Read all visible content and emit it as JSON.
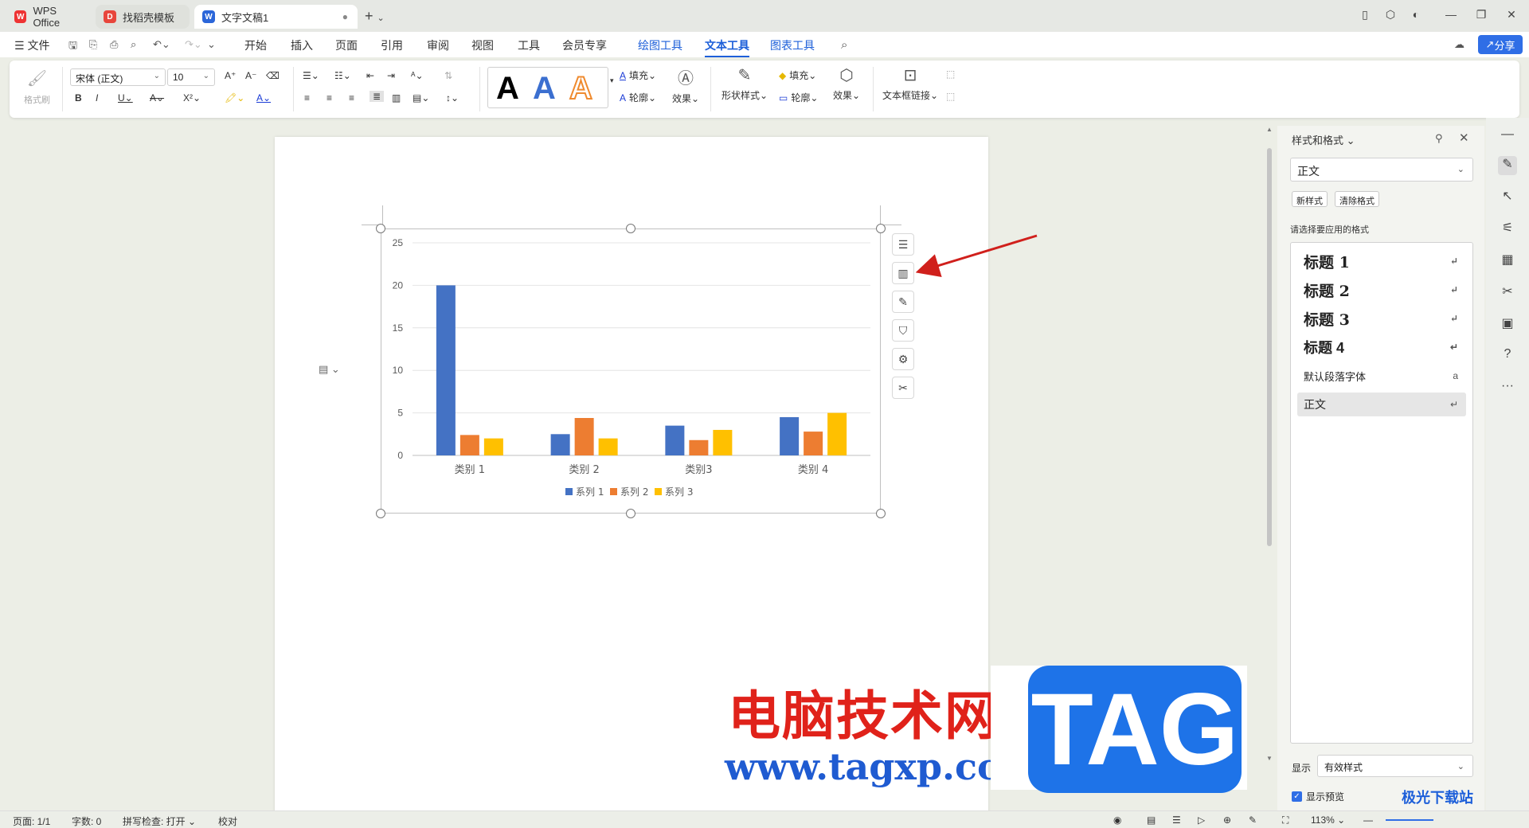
{
  "tabs": [
    {
      "label": "WPS Office",
      "icon": "wps-logo-icon"
    },
    {
      "label": "找稻壳模板",
      "icon": "docer-icon"
    },
    {
      "label": "文字文稿1",
      "icon": "writer-doc-icon"
    }
  ],
  "menu": {
    "file": "文件",
    "items": [
      "开始",
      "插入",
      "页面",
      "引用",
      "审阅",
      "视图",
      "工具",
      "会员专享",
      "绘图工具",
      "文本工具",
      "图表工具"
    ],
    "active": "文本工具",
    "share": "分享"
  },
  "ribbon": {
    "format_painter": "格式刷",
    "font_name": "宋体 (正文)",
    "font_size": "10",
    "fill": "填充",
    "outline": "轮廓",
    "effect": "效果",
    "shape_style": "形状样式",
    "shape_fill": "填充",
    "shape_outline": "轮廓",
    "shape_effect": "效果",
    "textbox_link": "文本框链接",
    "gallery": [
      "A",
      "A",
      "A"
    ]
  },
  "chart_data": {
    "type": "bar",
    "categories": [
      "类别 1",
      "类别 2",
      "类别3",
      "类别 4"
    ],
    "series": [
      {
        "name": "系列 1",
        "values": [
          20,
          2.5,
          3.5,
          4.5
        ],
        "color": "#4472c4"
      },
      {
        "name": "系列 2",
        "values": [
          2.4,
          4.4,
          1.8,
          2.8
        ],
        "color": "#ed7d31"
      },
      {
        "name": "系列 3",
        "values": [
          2,
          2,
          3,
          5
        ],
        "color": "#ffc000"
      }
    ],
    "yticks": [
      "0",
      "5",
      "10",
      "15",
      "20",
      "25"
    ],
    "ylim": [
      0,
      25
    ],
    "grid": true,
    "legend": "bottom"
  },
  "style_pane": {
    "title": "样式和格式",
    "current_style": "正文",
    "new_style": "新样式",
    "clear_format": "清除格式",
    "prompt": "请选择要应用的格式",
    "styles": [
      "标题 1",
      "标题 2",
      "标题 3",
      "标题 4",
      "默认段落字体",
      "正文"
    ],
    "show_label": "显示",
    "show_value": "有效样式",
    "preview_label": "显示预览"
  },
  "status": {
    "page": "页面: 1/1",
    "words": "字数: 0",
    "spell": "拼写检查: 打开",
    "proof": "校对",
    "zoom": "113%"
  },
  "watermark": {
    "cn": "电脑技术网",
    "url": "www.tagxp.com",
    "tag": "TAG",
    "site": "极光下载站"
  },
  "colors": {
    "accent": "#1d5fd9",
    "arrow": "#d0201c"
  }
}
